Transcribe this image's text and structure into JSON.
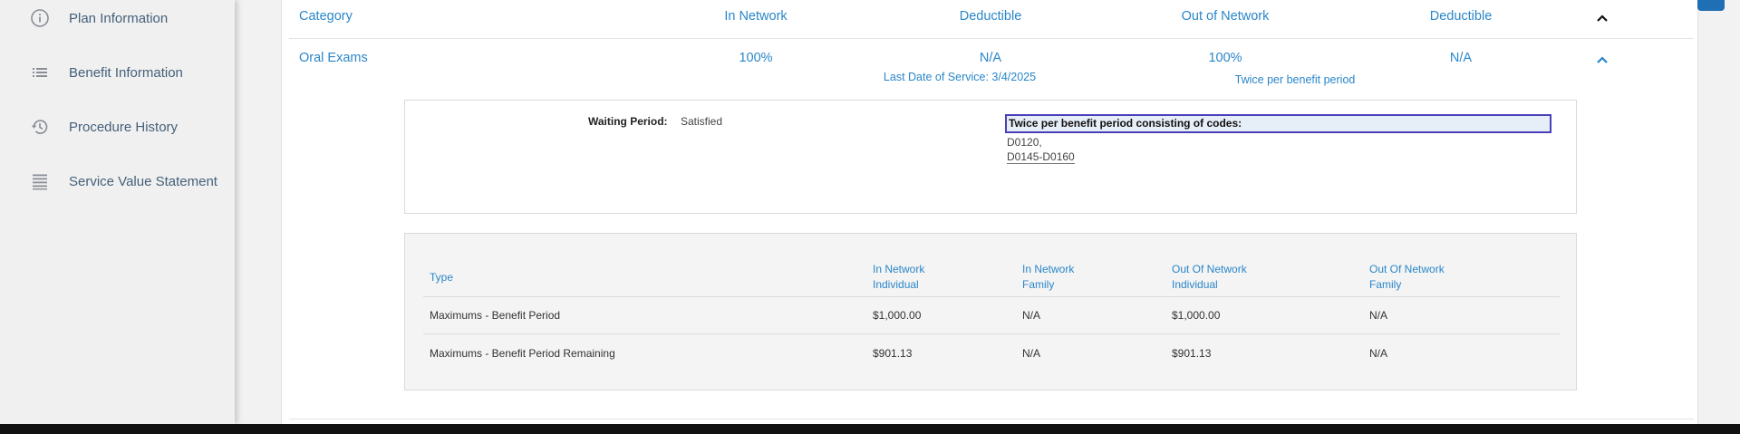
{
  "sidebar": {
    "items": [
      {
        "label": "Plan Information",
        "icon": "info-icon"
      },
      {
        "label": "Benefit Information",
        "icon": "list-icon"
      },
      {
        "label": "Procedure History",
        "icon": "history-icon"
      },
      {
        "label": "Service Value Statement",
        "icon": "statement-icon"
      }
    ]
  },
  "benefits": {
    "headers": {
      "category": "Category",
      "in_network": "In Network",
      "deductible": "Deductible",
      "out_of_network": "Out of Network",
      "oon_deductible": "Deductible"
    },
    "row": {
      "category": "Oral Exams",
      "in_network": "100%",
      "deductible": "N/A",
      "out_of_network": "100%",
      "oon_deductible": "N/A",
      "last_service": "Last Date of Service: 3/4/2025",
      "frequency": "Twice per benefit period"
    },
    "details": {
      "waiting_period_label": "Waiting Period:",
      "waiting_period_value": "Satisfied",
      "codes_title": "Twice per benefit period consisting of codes:",
      "codes": [
        "D0120,",
        "D0145-D0160"
      ]
    },
    "maximums": {
      "columns": [
        {
          "line1": "Type",
          "line2": ""
        },
        {
          "line1": "In Network",
          "line2": "Individual"
        },
        {
          "line1": "In Network",
          "line2": "Family"
        },
        {
          "line1": "Out Of Network",
          "line2": "Individual"
        },
        {
          "line1": "Out Of Network",
          "line2": "Family"
        }
      ],
      "rows": [
        [
          "Maximums - Benefit Period",
          "$1,000.00",
          "N/A",
          "$1,000.00",
          "N/A"
        ],
        [
          "Maximums - Benefit Period Remaining",
          "$901.13",
          "N/A",
          "$901.13",
          "N/A"
        ]
      ]
    }
  },
  "colors": {
    "accent": "#2a86c9",
    "sidebar_text": "#44607a",
    "focus_border": "#4a3fb8"
  }
}
